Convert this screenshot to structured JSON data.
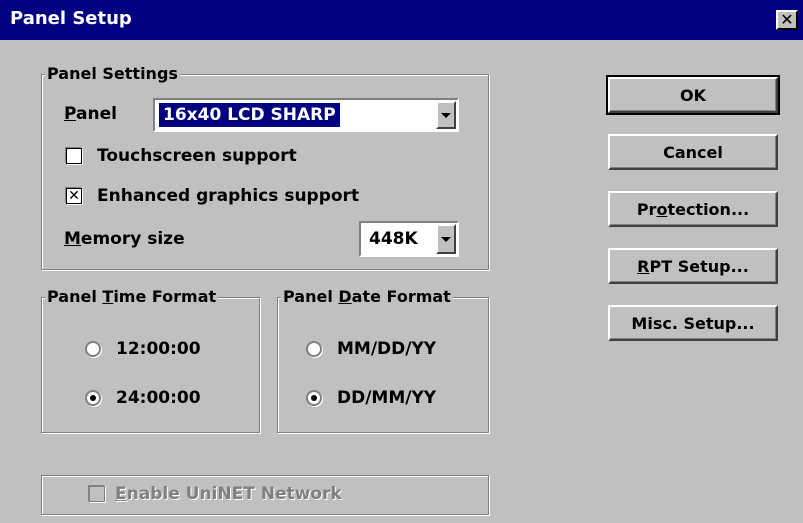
{
  "window": {
    "title": "Panel Setup",
    "close_glyph": "✕"
  },
  "panel_settings": {
    "legend": "Panel Settings",
    "panel_label_u": "P",
    "panel_label_rest": "anel",
    "panel_value": "16x40 LCD SHARP",
    "touchscreen_label": "Touchscreen support",
    "touchscreen_checked": false,
    "enhanced_label": "Enhanced graphics support",
    "enhanced_checked": true,
    "enhanced_mark": "✕",
    "memory_label_u": "M",
    "memory_label_rest": "emory size",
    "memory_value": "448K"
  },
  "time_format": {
    "legend_a": "Panel ",
    "legend_u": "T",
    "legend_b": "ime Format",
    "options": [
      "12:00:00",
      "24:00:00"
    ],
    "selected": "24:00:00"
  },
  "date_format": {
    "legend_a": "Panel ",
    "legend_u": "D",
    "legend_b": "ate Format",
    "options": [
      "MM/DD/YY",
      "DD/MM/YY"
    ],
    "selected": "DD/MM/YY"
  },
  "uninet": {
    "label_u": "E",
    "label_rest": "nable UniNET Network",
    "checked": false,
    "enabled": false
  },
  "buttons": {
    "ok": "OK",
    "cancel": "Cancel",
    "protection_a": "Pr",
    "protection_u": "o",
    "protection_b": "tection...",
    "rpt_u": "R",
    "rpt_b": "PT Setup...",
    "misc": "Misc. Setup..."
  },
  "colors": {
    "titlebar": "#000080",
    "face": "#c0c0c0",
    "selection": "#000080"
  }
}
